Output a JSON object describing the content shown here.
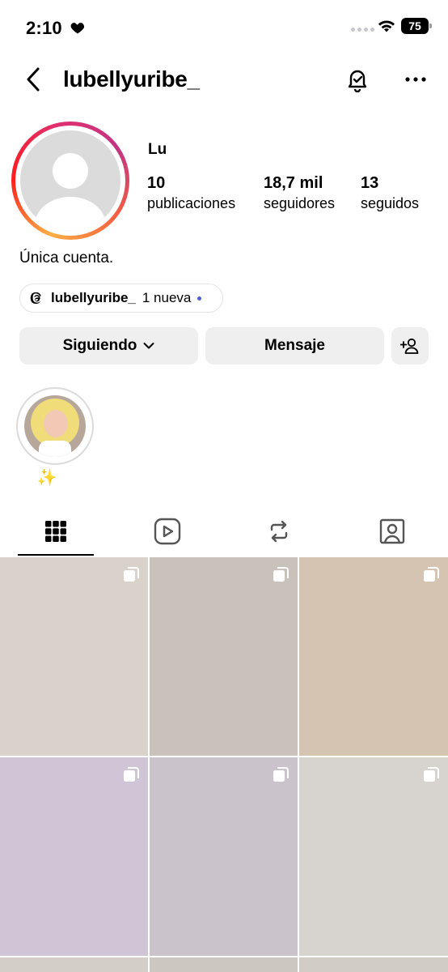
{
  "status_bar": {
    "time": "2:10",
    "battery": "75"
  },
  "header": {
    "username": "lubellyuribe_"
  },
  "profile": {
    "display_name": "Lu",
    "stats": [
      {
        "value": "10",
        "label": "publicaciones"
      },
      {
        "value": "18,7 mil",
        "label": "seguidores"
      },
      {
        "value": "13",
        "label": "seguidos"
      }
    ],
    "bio": "Única cuenta.",
    "threads": {
      "handle": "lubellyuribe_",
      "badge": "1 nueva"
    }
  },
  "actions": {
    "following_label": "Siguiendo",
    "message_label": "Mensaje"
  },
  "highlights": [
    {
      "label": "✨"
    }
  ],
  "tabs": [
    "grid-icon",
    "reels-icon",
    "reposts-icon",
    "tagged-icon"
  ],
  "posts": [
    {
      "multiple": true,
      "tone": "#d9d2ca"
    },
    {
      "multiple": true,
      "tone": "#c9c2bb"
    },
    {
      "multiple": true,
      "tone": "#d6c4b2"
    },
    {
      "multiple": true,
      "tone": "#cfc5d6"
    },
    {
      "multiple": true,
      "tone": "#cbc3cc"
    },
    {
      "multiple": true,
      "tone": "#d7d3cf"
    },
    {
      "multiple": false,
      "tone": "#d4cec8"
    },
    {
      "multiple": false,
      "tone": "#cdc7c2"
    },
    {
      "multiple": false,
      "tone": "#d2ccc6"
    }
  ],
  "colors": {
    "button_bg": "#efefef",
    "notice_dot": "#4f5bd5"
  }
}
